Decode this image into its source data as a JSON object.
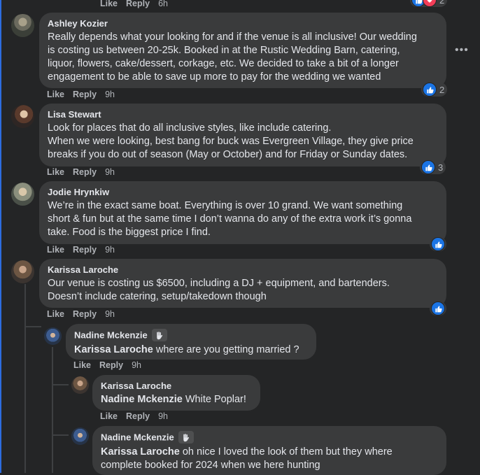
{
  "top_partial": {
    "like": "Like",
    "reply": "Reply",
    "time": "6h",
    "reaction_count": "2"
  },
  "comments": [
    {
      "author": "Ashley Kozier",
      "lines": [
        "Really depends what your looking for and if the venue is all inclusive! Our wedding",
        "is costing us between 20-25k. Booked in at the Rustic Wedding Barn, catering,",
        "liquor, flowers, cake/dessert, corkage, etc. We decided to take a bit of a longer",
        "engagement to be able to save up more to pay for the wedding we wanted"
      ],
      "like": "Like",
      "reply": "Reply",
      "time": "9h",
      "reaction_count": "2"
    },
    {
      "author": "Lisa Stewart",
      "lines": [
        "Look for places that do all inclusive styles, like include catering.",
        "When we were looking, best bang for buck was Evergreen Village, they give price",
        "breaks if you do out of season (May or October) and for Friday or Sunday dates."
      ],
      "like": "Like",
      "reply": "Reply",
      "time": "9h",
      "reaction_count": "3"
    },
    {
      "author": "Jodie Hrynkiw",
      "lines": [
        "We’re in the exact same boat. Everything is over 10 grand. We want something",
        "short & fun but at the same time I don’t wanna do any of the extra work it’s gonna",
        "take. Food is the biggest price I find."
      ],
      "like": "Like",
      "reply": "Reply",
      "time": "9h",
      "reaction_count": ""
    },
    {
      "author": "Karissa Laroche",
      "lines": [
        "Our venue is costing us $6500, including a DJ + equipment, and bartenders.",
        "Doesn’t include catering, setup/takedown though"
      ],
      "like": "Like",
      "reply": "Reply",
      "time": "9h",
      "reaction_count": ""
    }
  ],
  "replies": [
    {
      "author": "Nadine Mckenzie",
      "mention": "Karissa Laroche",
      "text": " where are you getting married ?",
      "like": "Like",
      "reply": "Reply",
      "time": "9h"
    },
    {
      "author": "Karissa Laroche",
      "mention": "Nadine Mckenzie",
      "text": " White Poplar!",
      "like": "Like",
      "reply": "Reply",
      "time": "9h"
    },
    {
      "author": "Nadine Mckenzie",
      "mention": "Karissa Laroche",
      "text": " oh nice I loved the look of them but they where",
      "text2": "complete booked for 2024 when we here hunting"
    }
  ],
  "menu_icon": "ellipsis-icon",
  "colors": {
    "background": "#242526",
    "bubble": "#3a3b3c",
    "accent": "#1b74e4",
    "muted": "#b0b3b8"
  }
}
